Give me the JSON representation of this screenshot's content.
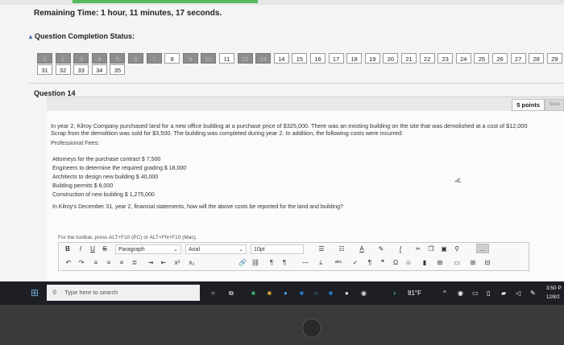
{
  "timer": {
    "label": "Remaining Time: 1 hour, 11 minutes, 17 seconds."
  },
  "completion": {
    "label": "Question Completion Status:"
  },
  "questions": {
    "row1": [
      {
        "n": "1",
        "done": true
      },
      {
        "n": "2",
        "done": true
      },
      {
        "n": "3",
        "done": true
      },
      {
        "n": "4",
        "done": true
      },
      {
        "n": "5",
        "done": true
      },
      {
        "n": "6",
        "done": true
      },
      {
        "n": "7",
        "done": true
      },
      {
        "n": "8",
        "done": false
      },
      {
        "n": "9",
        "done": true
      },
      {
        "n": "10",
        "done": true
      },
      {
        "n": "11",
        "done": false
      },
      {
        "n": "12",
        "done": true
      },
      {
        "n": "13",
        "done": true
      },
      {
        "n": "14",
        "done": false
      },
      {
        "n": "15",
        "done": false
      },
      {
        "n": "16",
        "done": false
      },
      {
        "n": "17",
        "done": false
      },
      {
        "n": "18",
        "done": false
      },
      {
        "n": "19",
        "done": false
      },
      {
        "n": "20",
        "done": false
      },
      {
        "n": "21",
        "done": false
      },
      {
        "n": "22",
        "done": false
      },
      {
        "n": "23",
        "done": false
      },
      {
        "n": "24",
        "done": false
      },
      {
        "n": "25",
        "done": false
      },
      {
        "n": "26",
        "done": false
      },
      {
        "n": "27",
        "done": false
      },
      {
        "n": "28",
        "done": false
      },
      {
        "n": "29",
        "done": false
      }
    ],
    "row2": [
      "31",
      "32",
      "33",
      "34",
      "35"
    ]
  },
  "question": {
    "title": "Question 14",
    "points": "5 points",
    "save": "Save",
    "line1": "In year 2, Kilroy Company purchased land for a new office building at a purchase price of $325,000. There was an existing building on the site that was demolished at a cost of $12,000",
    "line2": "Scrap from the demolition was sold for $3,500. The building was completed during year 2. In addition, the following costs were incurred:",
    "fees_heading": "Professional Fees:",
    "fees": [
      "Attorneys for the purchase contract  $ 7,500",
      "Engineers to determine the required grading $ 18,000",
      "Architects to design new building      $ 40,000",
      "Building permits         $ 8,000",
      "Construction of new building $ 1,275,000"
    ],
    "ask": "In Kilroy's December 31, year 2, financial statements, how will the above costs be reported for the land and building?"
  },
  "editor": {
    "hint": "For the toolbar, press ALT+F10 (PC) or ALT+FN+F10 (Mac).",
    "paragraph": "Paragraph",
    "font": "Arial",
    "size": "10pt",
    "more": "..."
  },
  "taskbar": {
    "search_placeholder": "Type here to search",
    "weather": "81°F",
    "time": "3:50 P",
    "date": "12/8/2"
  },
  "colors": {
    "accent": "#58b85c",
    "taskbar": "#1d1f24"
  }
}
